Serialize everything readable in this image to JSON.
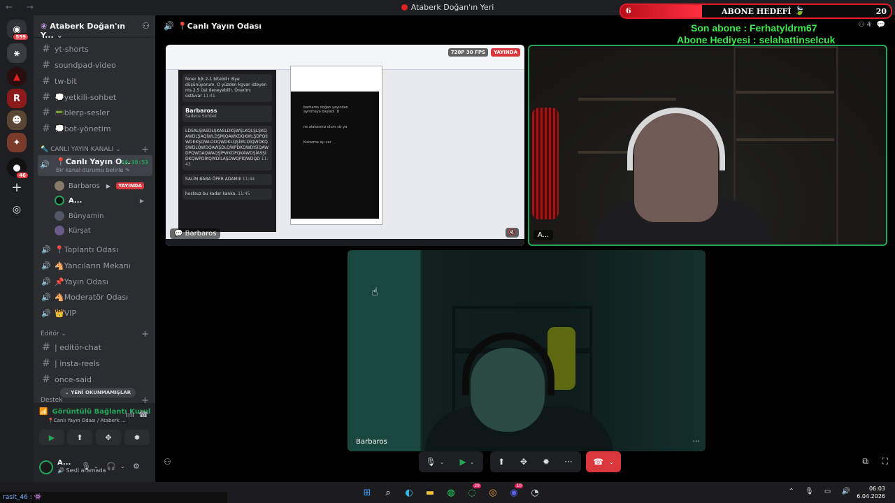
{
  "window": {
    "title": "Ataberk Doğan'ın Yeri",
    "nav": "← →",
    "controls": "— ☐ ✕"
  },
  "rail": [
    {
      "name": "discord-home",
      "icon": "discord-icon",
      "glyph": "◉",
      "badge": "559"
    },
    {
      "name": "server-1",
      "icon": "server-icon",
      "glyph": "⚹",
      "badge": ""
    },
    {
      "name": "server-2",
      "icon": "server-icon",
      "glyph": "▲",
      "badge": ""
    },
    {
      "name": "server-3",
      "icon": "server-icon",
      "glyph": "R",
      "badge": ""
    },
    {
      "name": "server-4",
      "icon": "server-icon",
      "glyph": "☻",
      "badge": ""
    },
    {
      "name": "server-5",
      "icon": "server-icon",
      "glyph": "✦",
      "badge": ""
    },
    {
      "name": "server-6",
      "icon": "server-icon",
      "glyph": "●",
      "badge": "46"
    }
  ],
  "rail_add": "+",
  "rail_explore": "◎",
  "server": {
    "name": "Ataberk Doğan'ın Y...",
    "icon": "❀",
    "chevron": "⌄",
    "invite": "⚇"
  },
  "text_channels": [
    {
      "label": "yt-shorts",
      "glyph": "#"
    },
    {
      "label": "soundpad-video",
      "glyph": "#"
    },
    {
      "label": "tw-bit",
      "glyph": "#"
    },
    {
      "label": "💭yetkili-sohbet",
      "glyph": "#"
    },
    {
      "label": "📟blerp-sesler",
      "glyph": "#"
    },
    {
      "label": "💭bot-yönetim",
      "glyph": "#"
    }
  ],
  "category_live": {
    "label": "🔦 CANLI YAYIN KANALI ⌄",
    "plus": "+"
  },
  "active_channel": {
    "label": "📍Canlı Yayın O...",
    "sub": "Bir kanal durumu belirle ✎",
    "timer": "16:30:53",
    "glyph": "🔊"
  },
  "voice_users": [
    {
      "name": "Barbaros",
      "live": "YAYINDA",
      "cam": "▶"
    },
    {
      "name": "A...",
      "cam": "▶"
    },
    {
      "name": "Bünyamin"
    },
    {
      "name": "Kürşat"
    }
  ],
  "voice_channels": [
    {
      "label": "📍Toplantı Odası",
      "glyph": "🔊"
    },
    {
      "label": "🐴Yancıların Mekanı",
      "glyph": "🔊"
    },
    {
      "label": "📌Yayın Odası",
      "glyph": "🔊"
    },
    {
      "label": "🐴Moderatör Odası",
      "glyph": "🔊"
    },
    {
      "label": "👑VIP",
      "glyph": "🔊"
    }
  ],
  "category_editor": {
    "label": "Editör ⌄",
    "plus": "+"
  },
  "editor_channels": [
    {
      "label": "| editör-chat",
      "glyph": "#"
    },
    {
      "label": "| insta-reels",
      "glyph": "#"
    },
    {
      "label": "once-said",
      "glyph": "#"
    }
  ],
  "category_support": {
    "label": "Destek",
    "plus": "+"
  },
  "new_unread": "⌄ YENİ OKUNMAMIŞLAR",
  "voice_panel": {
    "status": "Görüntülü Bağlantı Kurul",
    "location": "📍Canlı Yayın Odası / Ataberk ...",
    "signal": "📶",
    "wave": "ıılı",
    "disconnect": "☎",
    "buttons": [
      "▶",
      "⬆",
      "✥",
      "✹"
    ]
  },
  "user_panel": {
    "name": "A...",
    "status": "🔊 Sesli aramada",
    "mic": "🎙",
    "mic_caret": "⌄",
    "headset": "🎧",
    "head_caret": "⌄",
    "settings": "⚙"
  },
  "call_header": {
    "title": "📍Canlı Yayın Odası",
    "glyph": "🔊",
    "members": "⚇ 4",
    "chat": "💬"
  },
  "screen_tile": {
    "label": "💬 Barbaros",
    "fps": "720P 30 FPS",
    "live": "YAYINDA",
    "mute": "🔇",
    "msg1": "fener bjk 2-1 bitebilir diye düşünüyorum. O yüzden kgvar isteyen ms 2.5 üst deneyebilir. Önerim: üst&var",
    "msg1_time": "11:41",
    "sender": "Barbaross",
    "sender_sub": "Sadece Sohbet",
    "msg2": "LDSALŞIASDLŞKASLDKŞWŞLKQLŞLŞKQAWDLŞAQİWLDŞMJQAWKDQKWLŞDPQİIWDKKŞQWLODQWDKLQŞİWLDİQWDKQŞWDLQWDQAWŞDLQWPDKQWDİSİQAWDPQWDAQWAQŞİPWKDPQKAWDŞİASŞİDKQWPDİKQWDİLAŞDWQPİQWDQD",
    "msg2_time": "11:43",
    "msg3": "SALİM BABA ÖPER ADAMIII",
    "msg3_time": "11:44",
    "msg4": "hostsuz bu kadar kanka.",
    "msg4_time": "11:45",
    "paint_line1": "barbaros doğan yayından ayrılmaya başladı :D",
    "paint_line2": "ne alakasınız olum siz ya",
    "paint_line3": "Kokarma sşı ver"
  },
  "cam_a": {
    "label": "A..."
  },
  "cam_b": {
    "label": "Barbaros",
    "more": "···"
  },
  "controls": {
    "mic": "🎙",
    "mic_caret": "⌄",
    "cam": "▶",
    "cam_caret": "⌄",
    "share": "⬆",
    "activity": "✥",
    "soundboard": "✹",
    "more": "···",
    "leave": "☎",
    "leave_caret": "⌄",
    "popout": "⧉",
    "fullscreen": "⛶"
  },
  "overlay": {
    "current": "6",
    "label": "ABONE HEDEFİ",
    "leaf": "🍃",
    "goal": "20",
    "progress": 0.3,
    "last_sub": "Son abone : Ferhatyldrm67",
    "gift": "Abone Hediyesi : selahattinselcuk"
  },
  "chat_overlay": {
    "user": "rasit_46 :",
    "msg": "👾"
  },
  "taskbar": {
    "apps": [
      {
        "name": "windows-start",
        "glyph": "⊞",
        "badge": ""
      },
      {
        "name": "search",
        "glyph": "⌕",
        "badge": ""
      },
      {
        "name": "edge",
        "glyph": "◐",
        "badge": ""
      },
      {
        "name": "explorer",
        "glyph": "▬",
        "badge": ""
      },
      {
        "name": "spotify",
        "glyph": "◍",
        "badge": ""
      },
      {
        "name": "whatsapp",
        "glyph": "◌",
        "badge": "29"
      },
      {
        "name": "chrome",
        "glyph": "◎",
        "badge": ""
      },
      {
        "name": "discord",
        "glyph": "◉",
        "badge": "10"
      },
      {
        "name": "steam",
        "glyph": "◔",
        "badge": ""
      }
    ],
    "tray": "⌃ 🎙 ▭ 🔊",
    "time": "06:03",
    "date": "6.04.2026"
  }
}
